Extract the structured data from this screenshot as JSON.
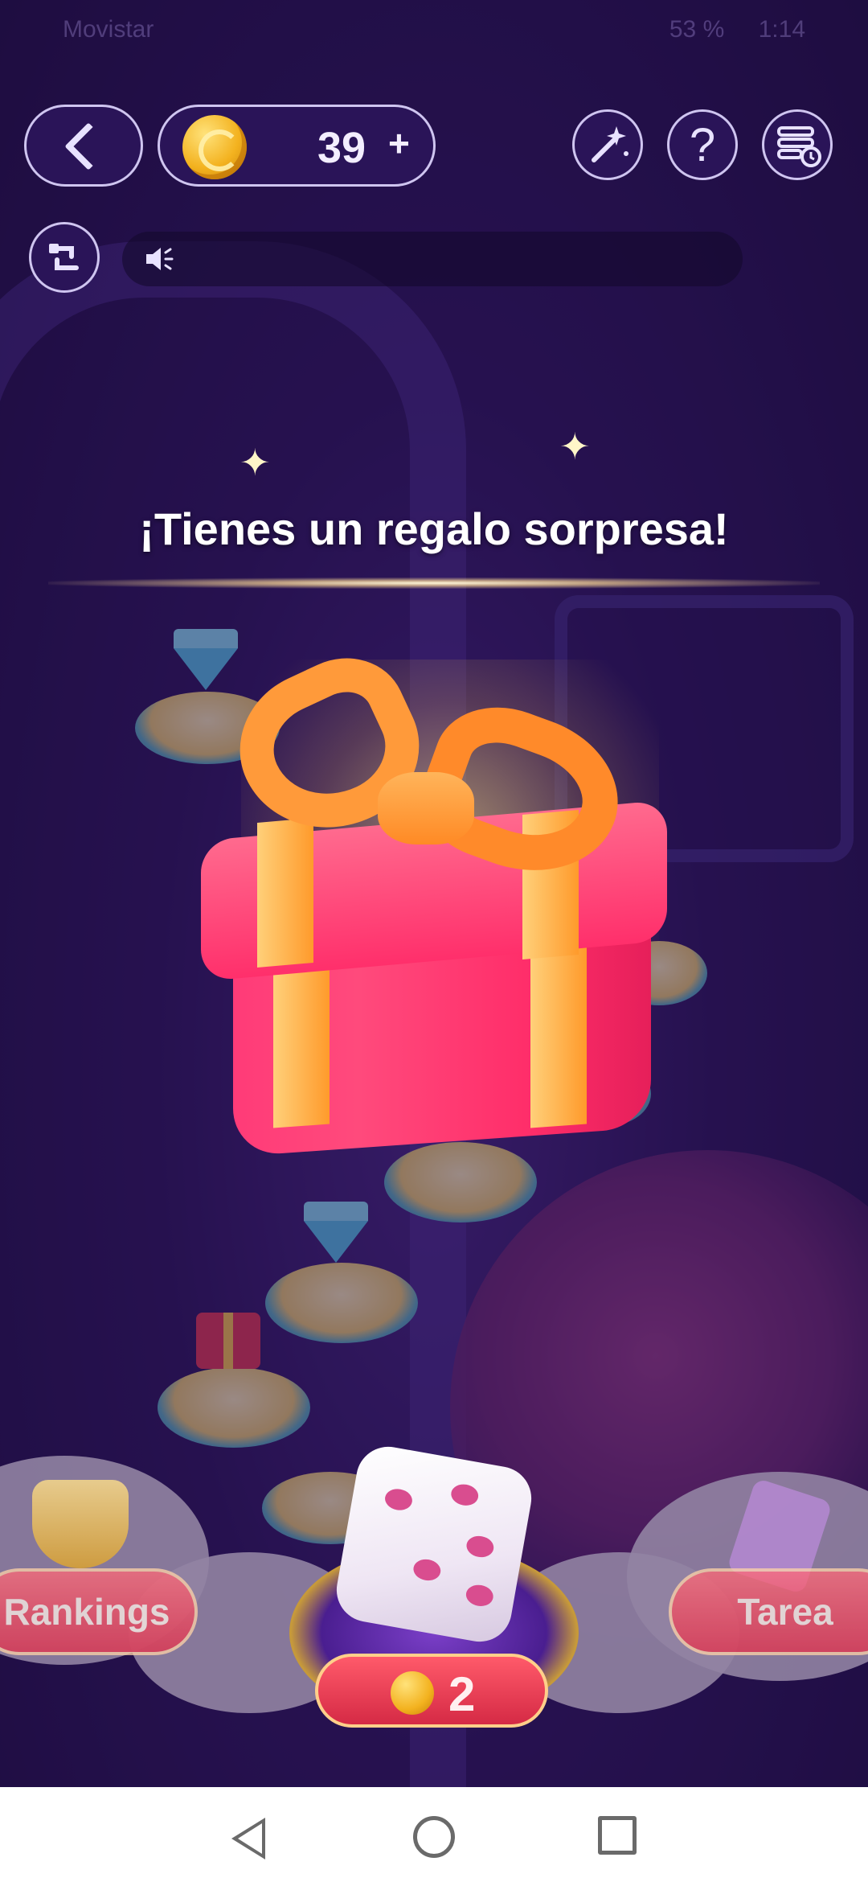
{
  "status_bar": {
    "carrier": "Movistar",
    "battery": "53 %",
    "time": "1:14"
  },
  "header": {
    "coin_balance": "39",
    "add_coins_symbol": "+",
    "help_symbol": "?"
  },
  "popup": {
    "title": "¡Tienes un regalo sorpresa!"
  },
  "bottom": {
    "rankings_label": "Rankings",
    "task_label": "Tarea",
    "roll_cost": "2"
  },
  "icons": {
    "back": "chevron-left-icon",
    "coin": "coin-icon",
    "magic": "magic-wand-icon",
    "help": "help-icon",
    "menu": "menu-clock-icon",
    "swap": "swap-icon",
    "speaker": "speaker-icon"
  },
  "colors": {
    "background": "#2d1760",
    "accent_red": "#e6324c",
    "gold": "#f3b21f"
  }
}
